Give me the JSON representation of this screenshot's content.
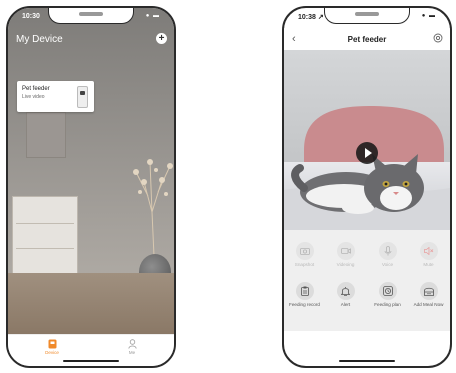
{
  "home": {
    "status_time": "10:30",
    "status_icons": "● ▬",
    "title": "My Device",
    "device": {
      "name": "Pet feeder",
      "status": "Live video"
    },
    "tabs": [
      {
        "label": "Device"
      },
      {
        "label": "Me"
      }
    ]
  },
  "feeder": {
    "status_time": "10:38 ↗",
    "status_icons": "● ▬",
    "title": "Pet feeder",
    "back_glyph": "‹",
    "actions_top": [
      {
        "label": "Snapshot",
        "icon": "camera-icon"
      },
      {
        "label": "Videoing",
        "icon": "video-camera-icon"
      },
      {
        "label": "Voice",
        "icon": "microphone-icon"
      },
      {
        "label": "Mute",
        "icon": "speaker-icon"
      }
    ],
    "actions_bottom": [
      {
        "label": "Feeding record",
        "icon": "clipboard-icon"
      },
      {
        "label": "Alert",
        "icon": "bell-icon"
      },
      {
        "label": "Feeding plan",
        "icon": "clock-icon"
      },
      {
        "label": "Add Meal Now",
        "icon": "bowl-icon"
      }
    ]
  },
  "colors": {
    "accent": "#f08a2b",
    "frame": "#2a2a2a",
    "control_bg": "#efefef"
  }
}
